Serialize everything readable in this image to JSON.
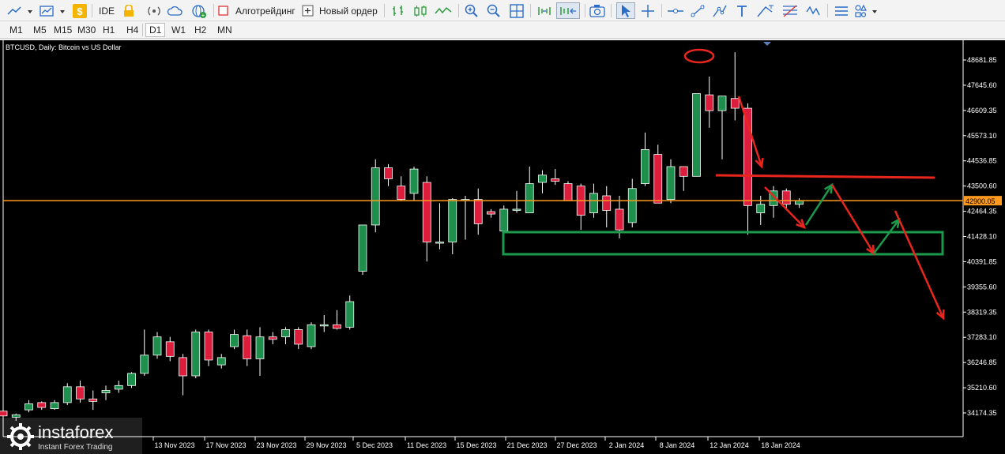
{
  "toolbar": {
    "ide_label": "IDE",
    "algo_label": "Алготрейдинг",
    "new_order_label": "Новый ордер"
  },
  "timeframes": [
    "M1",
    "M5",
    "M15",
    "M30",
    "H1",
    "H4",
    "D1",
    "W1",
    "H2",
    "MN"
  ],
  "active_timeframe": "D1",
  "chart": {
    "symbol_label": "BTCUSD, Daily:  Bitcoin vs US Dollar",
    "current_price_label": "42900.05",
    "price_ticks": [
      "48681.85",
      "47645.60",
      "46609.35",
      "45573.10",
      "44536.85",
      "43500.60",
      "42464.35",
      "41428.10",
      "40391.85",
      "39355.60",
      "38319.35",
      "37283.10",
      "36246.85",
      "35210.60",
      "34174.35"
    ],
    "date_ticks": [
      "13 Nov 2023",
      "17 Nov 2023",
      "23 Nov 2023",
      "29 Nov 2023",
      "5 Dec 2023",
      "11 Dec 2023",
      "15 Dec 2023",
      "21 Dec 2023",
      "27 Dec 2023",
      "2 Jan 2024",
      "8 Jan 2024",
      "12 Jan 2024",
      "18 Jan 2024"
    ],
    "colors": {
      "background": "#000000",
      "bull": "#1f8f4e",
      "bear": "#dc1e3c",
      "price_line": "#ff9a1f",
      "grid": "#000000",
      "axis_text": "#ffffff",
      "annotation_red": "#e8261e",
      "annotation_green": "#1a9a4a"
    },
    "candles": [
      {
        "o": 34250,
        "h": 34300,
        "l": 33900,
        "c": 34050
      },
      {
        "o": 34000,
        "h": 34150,
        "l": 33850,
        "c": 34100
      },
      {
        "o": 34300,
        "h": 34700,
        "l": 34200,
        "c": 34550
      },
      {
        "o": 34600,
        "h": 34650,
        "l": 34300,
        "c": 34400
      },
      {
        "o": 34350,
        "h": 34700,
        "l": 34300,
        "c": 34600
      },
      {
        "o": 34600,
        "h": 35400,
        "l": 34500,
        "c": 35250
      },
      {
        "o": 35250,
        "h": 35500,
        "l": 34600,
        "c": 34750
      },
      {
        "o": 34750,
        "h": 35100,
        "l": 34300,
        "c": 34650
      },
      {
        "o": 35000,
        "h": 35300,
        "l": 34700,
        "c": 35100
      },
      {
        "o": 35150,
        "h": 35500,
        "l": 35000,
        "c": 35300
      },
      {
        "o": 35300,
        "h": 35850,
        "l": 35200,
        "c": 35800
      },
      {
        "o": 35800,
        "h": 37600,
        "l": 35700,
        "c": 36550
      },
      {
        "o": 36550,
        "h": 37500,
        "l": 36400,
        "c": 37300
      },
      {
        "o": 37100,
        "h": 37300,
        "l": 36300,
        "c": 36500
      },
      {
        "o": 36450,
        "h": 36600,
        "l": 34900,
        "c": 35700
      },
      {
        "o": 35700,
        "h": 37600,
        "l": 35600,
        "c": 37500
      },
      {
        "o": 37500,
        "h": 37600,
        "l": 36100,
        "c": 36350
      },
      {
        "o": 36150,
        "h": 36600,
        "l": 36000,
        "c": 36450
      },
      {
        "o": 36900,
        "h": 37600,
        "l": 36800,
        "c": 37400
      },
      {
        "o": 37350,
        "h": 37600,
        "l": 36100,
        "c": 36400
      },
      {
        "o": 36400,
        "h": 37700,
        "l": 35700,
        "c": 37300
      },
      {
        "o": 37300,
        "h": 37500,
        "l": 37000,
        "c": 37200
      },
      {
        "o": 37300,
        "h": 37700,
        "l": 37000,
        "c": 37600
      },
      {
        "o": 37600,
        "h": 37700,
        "l": 36800,
        "c": 37000
      },
      {
        "o": 36900,
        "h": 37900,
        "l": 36800,
        "c": 37800
      },
      {
        "o": 37750,
        "h": 38200,
        "l": 37500,
        "c": 37800
      },
      {
        "o": 37800,
        "h": 38400,
        "l": 37600,
        "c": 37650
      },
      {
        "o": 37700,
        "h": 39000,
        "l": 37600,
        "c": 38750
      },
      {
        "o": 40000,
        "h": 41700,
        "l": 39850,
        "c": 41900
      },
      {
        "o": 41900,
        "h": 44600,
        "l": 41600,
        "c": 44250
      },
      {
        "o": 44250,
        "h": 44400,
        "l": 43500,
        "c": 43800
      },
      {
        "o": 43500,
        "h": 43900,
        "l": 42900,
        "c": 42950
      },
      {
        "o": 43200,
        "h": 44300,
        "l": 42900,
        "c": 44200
      },
      {
        "o": 43650,
        "h": 43900,
        "l": 40400,
        "c": 41200
      },
      {
        "o": 41200,
        "h": 42800,
        "l": 40900,
        "c": 41200
      },
      {
        "o": 41200,
        "h": 43000,
        "l": 40700,
        "c": 42950
      },
      {
        "o": 42950,
        "h": 43100,
        "l": 41300,
        "c": 42950
      },
      {
        "o": 42950,
        "h": 43400,
        "l": 41500,
        "c": 41950
      },
      {
        "o": 42450,
        "h": 42550,
        "l": 42200,
        "c": 42350
      },
      {
        "o": 41650,
        "h": 42700,
        "l": 40700,
        "c": 42550
      },
      {
        "o": 42550,
        "h": 43300,
        "l": 42400,
        "c": 42550
      },
      {
        "o": 42400,
        "h": 44300,
        "l": 42400,
        "c": 43600
      },
      {
        "o": 43650,
        "h": 44150,
        "l": 43200,
        "c": 43950
      },
      {
        "o": 43800,
        "h": 44200,
        "l": 43550,
        "c": 43700
      },
      {
        "o": 43600,
        "h": 43700,
        "l": 42900,
        "c": 42900
      },
      {
        "o": 43500,
        "h": 43600,
        "l": 41700,
        "c": 42300
      },
      {
        "o": 42400,
        "h": 43600,
        "l": 42200,
        "c": 43200
      },
      {
        "o": 43100,
        "h": 43500,
        "l": 41800,
        "c": 42500
      },
      {
        "o": 42550,
        "h": 43100,
        "l": 41350,
        "c": 41700
      },
      {
        "o": 42000,
        "h": 43800,
        "l": 41800,
        "c": 43400
      },
      {
        "o": 43600,
        "h": 45700,
        "l": 43500,
        "c": 45000
      },
      {
        "o": 44800,
        "h": 45200,
        "l": 42800,
        "c": 42800
      },
      {
        "o": 42950,
        "h": 44600,
        "l": 42800,
        "c": 44300
      },
      {
        "o": 44300,
        "h": 44300,
        "l": 43300,
        "c": 43900
      },
      {
        "o": 43900,
        "h": 47300,
        "l": 43900,
        "c": 47300
      },
      {
        "o": 47250,
        "h": 48000,
        "l": 45900,
        "c": 46600
      },
      {
        "o": 46600,
        "h": 47200,
        "l": 44600,
        "c": 47200
      },
      {
        "o": 47100,
        "h": 49000,
        "l": 46200,
        "c": 46700
      },
      {
        "o": 46700,
        "h": 46900,
        "l": 41500,
        "c": 42700
      },
      {
        "o": 42400,
        "h": 43100,
        "l": 41900,
        "c": 42750
      },
      {
        "o": 42700,
        "h": 43500,
        "l": 42200,
        "c": 43300
      },
      {
        "o": 43300,
        "h": 43400,
        "l": 42500,
        "c": 42750
      },
      {
        "o": 42750,
        "h": 43000,
        "l": 42600,
        "c": 42900
      }
    ]
  }
}
